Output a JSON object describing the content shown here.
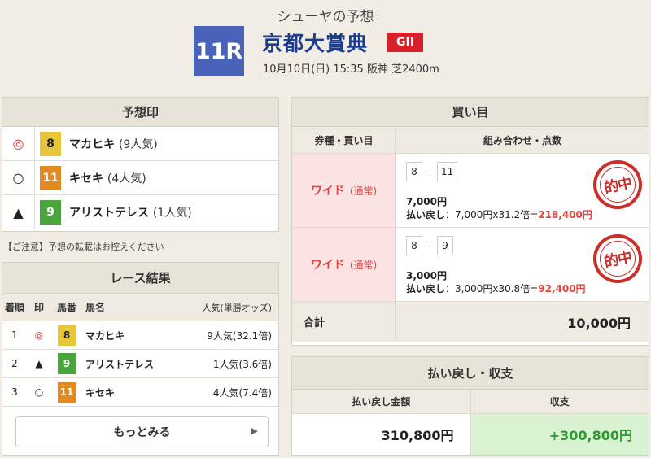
{
  "header": {
    "predictor": "シューヤの予想",
    "race_number": "11R",
    "race_name": "京都大賞典",
    "grade": "GII",
    "info": "10月10日(日) 15:35 阪神 芝2400m"
  },
  "prediction": {
    "title": "予想印",
    "rows": [
      {
        "mark": "◎",
        "num": "8",
        "name": "マカヒキ",
        "pop": "(9人気)",
        "color": "yellow"
      },
      {
        "mark": "○",
        "num": "11",
        "name": "キセキ",
        "pop": "(4人気)",
        "color": "orange"
      },
      {
        "mark": "▲",
        "num": "9",
        "name": "アリストテレス",
        "pop": "(1人気)",
        "color": "green"
      }
    ]
  },
  "notice": "【ご注意】予想の転載はお控えください",
  "results": {
    "title": "レース結果",
    "headers": {
      "rank": "着順",
      "mark": "印",
      "num": "馬番",
      "name": "馬名",
      "pop": "人気(単勝オッズ)"
    },
    "rows": [
      {
        "rank": "1",
        "mark": "◎",
        "num": "8",
        "name": "マカヒキ",
        "pop": "9人気(32.1倍)",
        "color": "yellow"
      },
      {
        "rank": "2",
        "mark": "▲",
        "num": "9",
        "name": "アリストテレス",
        "pop": "1人気(3.6倍)",
        "color": "green"
      },
      {
        "rank": "3",
        "mark": "○",
        "num": "11",
        "name": "キセキ",
        "pop": "4人気(7.4倍)",
        "color": "orange"
      }
    ],
    "more_label": "もっとみる"
  },
  "bets": {
    "title": "買い目",
    "headers": {
      "type": "券種・買い目",
      "combo": "組み合わせ・点数"
    },
    "rows": [
      {
        "type": "ワイド",
        "subtype": "(通常)",
        "a": "8",
        "b": "11",
        "amount": "7,000円",
        "payout_label": "払い戻し",
        "payout_calc": "：7,000円x31.2倍=",
        "payout_value": "218,400円",
        "stamp": "的中"
      },
      {
        "type": "ワイド",
        "subtype": "(通常)",
        "a": "8",
        "b": "9",
        "amount": "3,000円",
        "payout_label": "払い戻し",
        "payout_calc": "：3,000円x30.8倍=",
        "payout_value": "92,400円",
        "stamp": "的中"
      }
    ],
    "total_label": "合計",
    "total_value": "10,000円"
  },
  "payout": {
    "title": "払い戻し・収支",
    "refund_header": "払い戻し金額",
    "profit_header": "収支",
    "refund_value": "310,800円",
    "profit_value": "+300,800円"
  }
}
